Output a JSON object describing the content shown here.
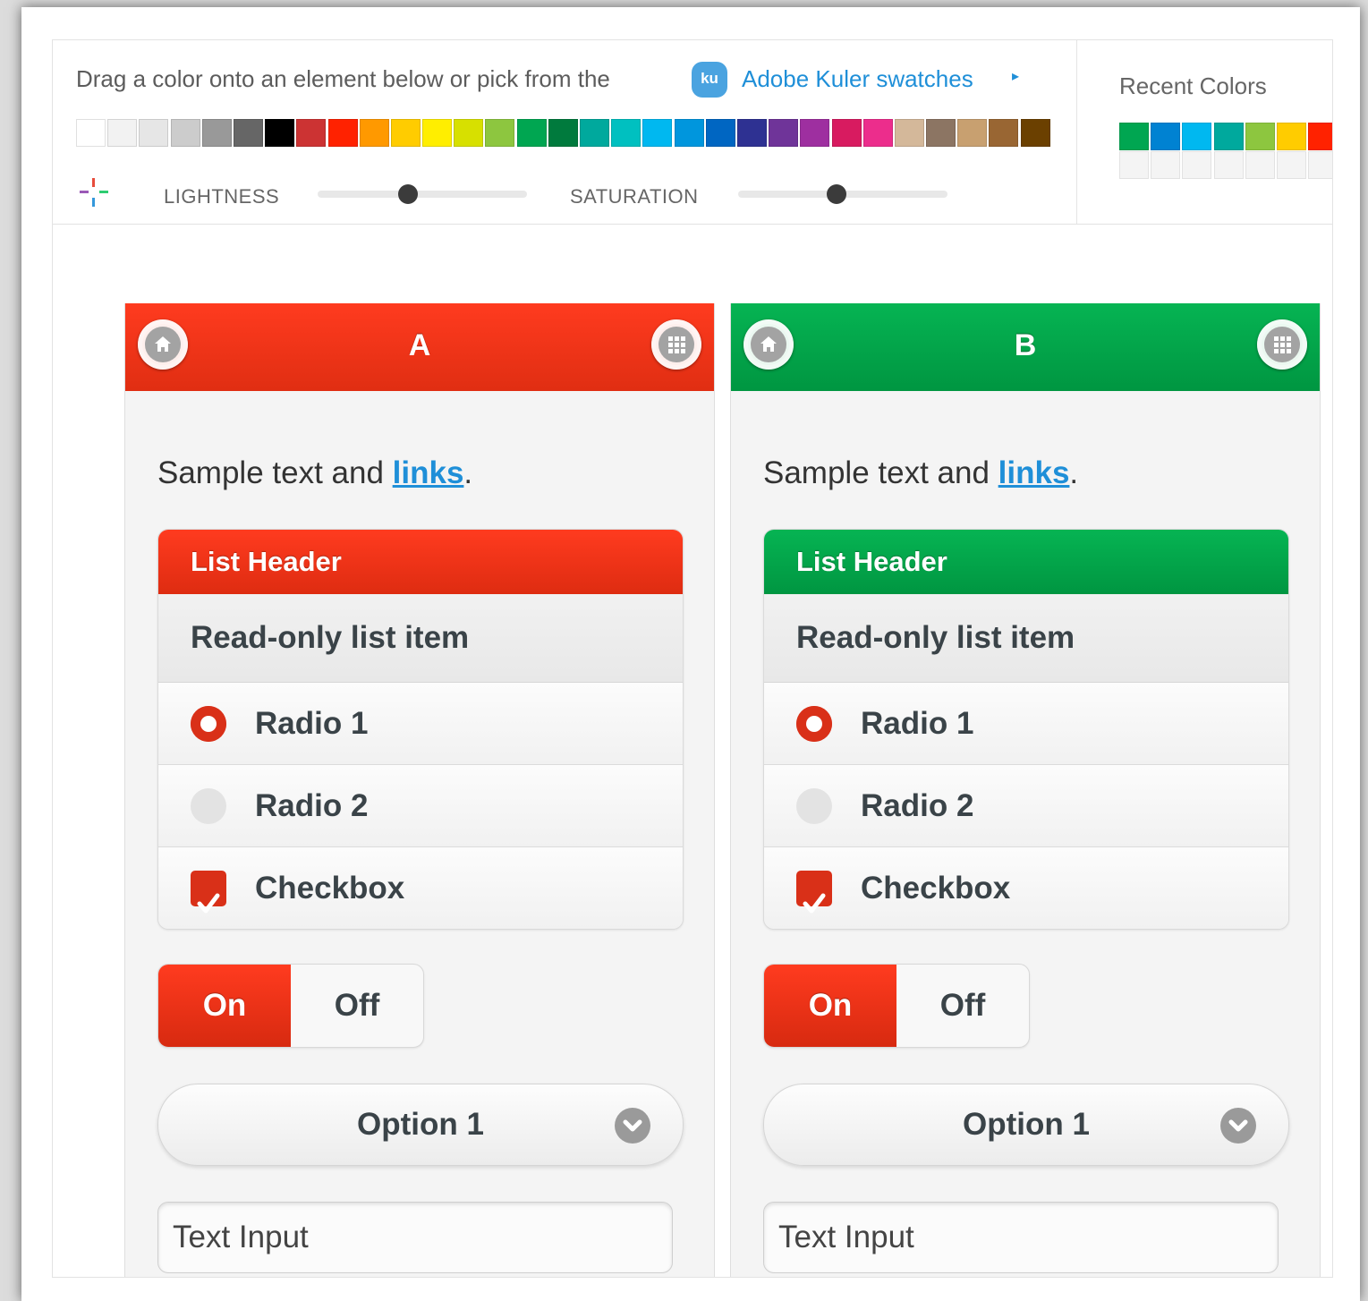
{
  "toolbar": {
    "instructions": "Drag a color onto an element below or pick from the",
    "kuler_icon_text": "ku",
    "kuler_link": "Adobe Kuler swatches",
    "kuler_arrow": "▸",
    "lightness_label": "LIGHTNESS",
    "lightness_value": 0.43,
    "saturation_label": "SATURATION",
    "saturation_value": 0.47,
    "swatches": [
      "#ffffff",
      "#f2f2f2",
      "#e6e6e6",
      "#cccccc",
      "#999999",
      "#666666",
      "#000000",
      "#cc3333",
      "#ff2200",
      "#ff9900",
      "#ffcc00",
      "#ffee00",
      "#d7e000",
      "#8dc63f",
      "#00a651",
      "#007a3d",
      "#00a99d",
      "#00c0c0",
      "#00b8f0",
      "#0096dd",
      "#0066c2",
      "#2e3192",
      "#6f3499",
      "#9e2fa0",
      "#d81b60",
      "#ec2d8c",
      "#d4b89a",
      "#8c7563",
      "#c8a070",
      "#996633",
      "#6b4000"
    ]
  },
  "recent": {
    "label": "Recent Colors",
    "colors": [
      "#00a651",
      "#0082d2",
      "#00b8f0",
      "#00a99d",
      "#8dc63f",
      "#ffcc00",
      "#ff2200"
    ],
    "empty_slots": 7
  },
  "panels": [
    {
      "id": "a",
      "title": "A",
      "theme_color": "#ff3a1f",
      "sample_text": "Sample text and ",
      "sample_link": "links",
      "sample_end": ".",
      "list_header": "List Header",
      "readonly_item": "Read-only list item",
      "radio1": "Radio 1",
      "radio2": "Radio 2",
      "checkbox": "Checkbox",
      "toggle_on": "On",
      "toggle_off": "Off",
      "select_value": "Option 1",
      "text_input_placeholder": "Text Input"
    },
    {
      "id": "b",
      "title": "B",
      "theme_color": "#00a84d",
      "sample_text": "Sample text and ",
      "sample_link": "links",
      "sample_end": ".",
      "list_header": "List Header",
      "readonly_item": "Read-only list item",
      "radio1": "Radio 1",
      "radio2": "Radio 2",
      "checkbox": "Checkbox",
      "toggle_on": "On",
      "toggle_off": "Off",
      "select_value": "Option 1",
      "text_input_placeholder": "Text Input"
    }
  ],
  "icons": {
    "header_left": "home-icon",
    "header_right": "grid-icon",
    "select": "chevron-down-icon",
    "checkbox": "checkmark-icon",
    "picker": "eyedropper-icon"
  }
}
